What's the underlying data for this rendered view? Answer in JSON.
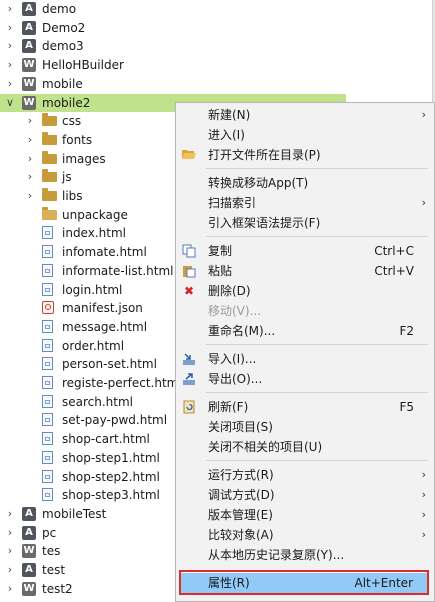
{
  "tree": {
    "items": [
      {
        "label": "demo",
        "kind": "project-a",
        "arrow": "collapsed"
      },
      {
        "label": "Demo2",
        "kind": "project-a",
        "arrow": "collapsed"
      },
      {
        "label": "demo3",
        "kind": "project-a",
        "arrow": "collapsed"
      },
      {
        "label": "HelloHBuilder",
        "kind": "project-w",
        "arrow": "collapsed"
      },
      {
        "label": "mobile",
        "kind": "project-w",
        "arrow": "collapsed"
      },
      {
        "label": "mobile2",
        "kind": "project-w",
        "arrow": "expanded",
        "selected": true
      },
      {
        "label": "css",
        "kind": "folder",
        "arrow": "collapsed"
      },
      {
        "label": "fonts",
        "kind": "folder",
        "arrow": "collapsed"
      },
      {
        "label": "images",
        "kind": "folder",
        "arrow": "collapsed"
      },
      {
        "label": "js",
        "kind": "folder",
        "arrow": "collapsed"
      },
      {
        "label": "libs",
        "kind": "folder",
        "arrow": "collapsed"
      },
      {
        "label": "unpackage",
        "kind": "folder-light",
        "arrow": "none"
      },
      {
        "label": "index.html",
        "kind": "html",
        "arrow": "none"
      },
      {
        "label": "infomate.html",
        "kind": "html",
        "arrow": "none"
      },
      {
        "label": "informate-list.html",
        "kind": "html",
        "arrow": "none"
      },
      {
        "label": "login.html",
        "kind": "html",
        "arrow": "none"
      },
      {
        "label": "manifest.json",
        "kind": "json",
        "arrow": "none"
      },
      {
        "label": "message.html",
        "kind": "html",
        "arrow": "none"
      },
      {
        "label": "order.html",
        "kind": "html",
        "arrow": "none"
      },
      {
        "label": "person-set.html",
        "kind": "html",
        "arrow": "none"
      },
      {
        "label": "registe-perfect.html",
        "kind": "html",
        "arrow": "none"
      },
      {
        "label": "search.html",
        "kind": "html",
        "arrow": "none"
      },
      {
        "label": "set-pay-pwd.html",
        "kind": "html",
        "arrow": "none"
      },
      {
        "label": "shop-cart.html",
        "kind": "html",
        "arrow": "none"
      },
      {
        "label": "shop-step1.html",
        "kind": "html",
        "arrow": "none"
      },
      {
        "label": "shop-step2.html",
        "kind": "html",
        "arrow": "none"
      },
      {
        "label": "shop-step3.html",
        "kind": "html",
        "arrow": "none"
      },
      {
        "label": "mobileTest",
        "kind": "project-a",
        "arrow": "collapsed"
      },
      {
        "label": "pc",
        "kind": "project-a",
        "arrow": "collapsed"
      },
      {
        "label": "tes",
        "kind": "project-w",
        "arrow": "collapsed"
      },
      {
        "label": "test",
        "kind": "project-a",
        "arrow": "collapsed"
      },
      {
        "label": "test2",
        "kind": "project-w",
        "arrow": "collapsed"
      }
    ]
  },
  "menu": {
    "new": {
      "label": "新建(N)"
    },
    "enter": {
      "label": "进入(I)"
    },
    "open_folder": {
      "label": "打开文件所在目录(P)"
    },
    "convert_app": {
      "label": "转换成移动App(T)"
    },
    "scan_index": {
      "label": "扫描索引"
    },
    "framework_hint": {
      "label": "引入框架语法提示(F)"
    },
    "copy": {
      "label": "复制",
      "shortcut": "Ctrl+C"
    },
    "paste": {
      "label": "粘贴",
      "shortcut": "Ctrl+V"
    },
    "delete": {
      "label": "删除(D)"
    },
    "move": {
      "label": "移动(V)..."
    },
    "rename": {
      "label": "重命名(M)...",
      "shortcut": "F2"
    },
    "import": {
      "label": "导入(I)..."
    },
    "export": {
      "label": "导出(O)..."
    },
    "refresh": {
      "label": "刷新(F)",
      "shortcut": "F5"
    },
    "close_project": {
      "label": "关闭项目(S)"
    },
    "close_unrelated": {
      "label": "关闭不相关的项目(U)"
    },
    "run_as": {
      "label": "运行方式(R)"
    },
    "debug_as": {
      "label": "调试方式(D)"
    },
    "version_control": {
      "label": "版本管理(E)"
    },
    "compare": {
      "label": "比较对象(A)"
    },
    "restore_history": {
      "label": "从本地历史记录复原(Y)..."
    },
    "properties": {
      "label": "属性(R)",
      "shortcut": "Alt+Enter"
    }
  },
  "colors": {
    "selection": "#bfe28b",
    "menu_highlight": "#91c9f7",
    "outline": "#e02b2b"
  }
}
